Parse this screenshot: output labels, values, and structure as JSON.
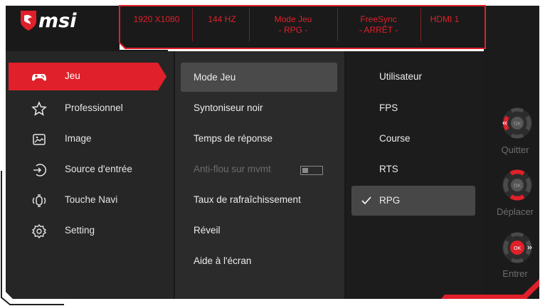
{
  "brand": {
    "name": "msi",
    "accent": "#e0202a"
  },
  "status_bar": [
    {
      "id": "resolution",
      "line1": "1920 X1080",
      "line2": ""
    },
    {
      "id": "refresh",
      "line1": "144 HZ",
      "line2": ""
    },
    {
      "id": "game-mode",
      "line1": "Mode Jeu",
      "line2": "- RPG -"
    },
    {
      "id": "freesync",
      "line1": "FreeSync",
      "line2": "- ARRÊT -"
    },
    {
      "id": "input",
      "line1": "HDMI 1",
      "line2": ""
    }
  ],
  "main_menu": [
    {
      "label": "Jeu",
      "icon": "gamepad-icon",
      "active": true
    },
    {
      "label": "Professionnel",
      "icon": "star-icon",
      "active": false
    },
    {
      "label": "Image",
      "icon": "image-icon",
      "active": false
    },
    {
      "label": "Source d'entrée",
      "icon": "input-source-icon",
      "active": false
    },
    {
      "label": "Touche Navi",
      "icon": "navi-key-icon",
      "active": false
    },
    {
      "label": "Setting",
      "icon": "gear-icon",
      "active": false
    }
  ],
  "sub_menu": [
    {
      "label": "Mode Jeu",
      "active": true,
      "disabled": false
    },
    {
      "label": "Syntoniseur noir",
      "active": false,
      "disabled": false
    },
    {
      "label": "Temps de réponse",
      "active": false,
      "disabled": false
    },
    {
      "label": "Anti-flou sur mvmt",
      "active": false,
      "disabled": true,
      "toggle": "off"
    },
    {
      "label": "Taux de rafraîchissement",
      "active": false,
      "disabled": false
    },
    {
      "label": "Réveil",
      "active": false,
      "disabled": false
    },
    {
      "label": "Aide à l'écran",
      "active": false,
      "disabled": false
    }
  ],
  "options": [
    {
      "label": "Utilisateur",
      "selected": false
    },
    {
      "label": "FPS",
      "selected": false
    },
    {
      "label": "Course",
      "selected": false
    },
    {
      "label": "RTS",
      "selected": false
    },
    {
      "label": "RPG",
      "selected": true
    }
  ],
  "nav_hints": [
    {
      "label": "Quitter",
      "key": "OK",
      "icon": "joystick-left-icon"
    },
    {
      "label": "Déplacer",
      "key": "OK",
      "icon": "joystick-updown-icon"
    },
    {
      "label": "Entrer",
      "key": "OK",
      "icon": "joystick-press-icon"
    }
  ],
  "colors": {
    "panel_dark": "#1e1e1e",
    "panel_mid": "#2a2a2a",
    "highlight": "#e0202a"
  }
}
